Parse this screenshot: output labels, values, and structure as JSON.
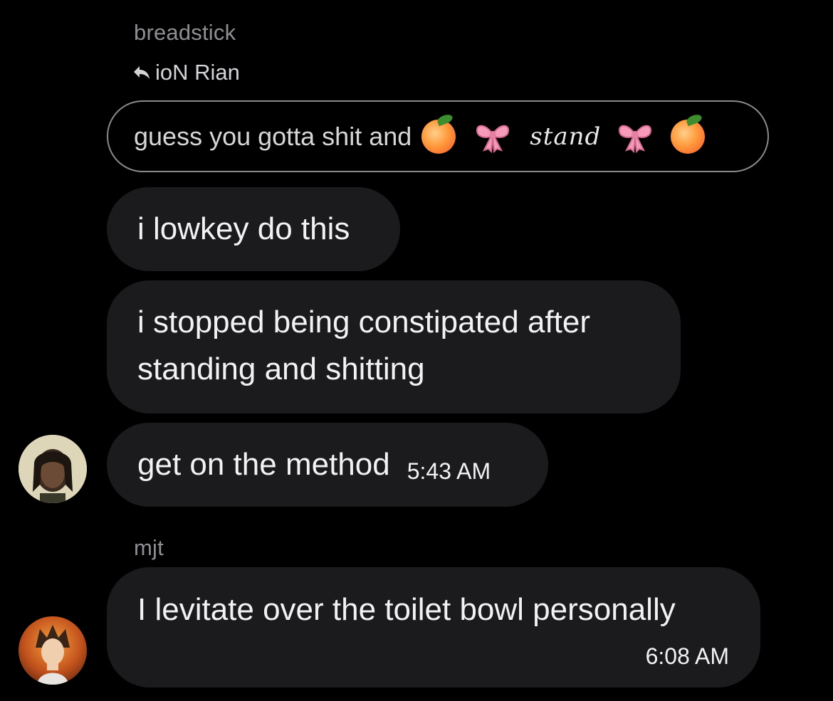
{
  "thread": {
    "sender1": "breadstick",
    "reply_to": "ioN Rian",
    "quoted_text": "guess you gotta shit and",
    "quoted_word": "stand",
    "messages": [
      {
        "text": "i lowkey do this"
      },
      {
        "text": "i stopped being constipated after standing and shitting"
      },
      {
        "text": "get on the method",
        "time": "5:43 AM"
      }
    ],
    "sender2": "mjt",
    "messages2": [
      {
        "text": "I levitate over the toilet bowl personally",
        "time": "6:08 AM"
      }
    ]
  },
  "icons": {
    "reply": "reply-arrow-icon",
    "peach": "peach-emoji-icon",
    "bow": "ribbon-bow-emoji-icon"
  },
  "colors": {
    "background": "#000000",
    "bubble": "#1b1b1d",
    "sender_name": "#8e8e93",
    "text": "#f2f2f4"
  }
}
